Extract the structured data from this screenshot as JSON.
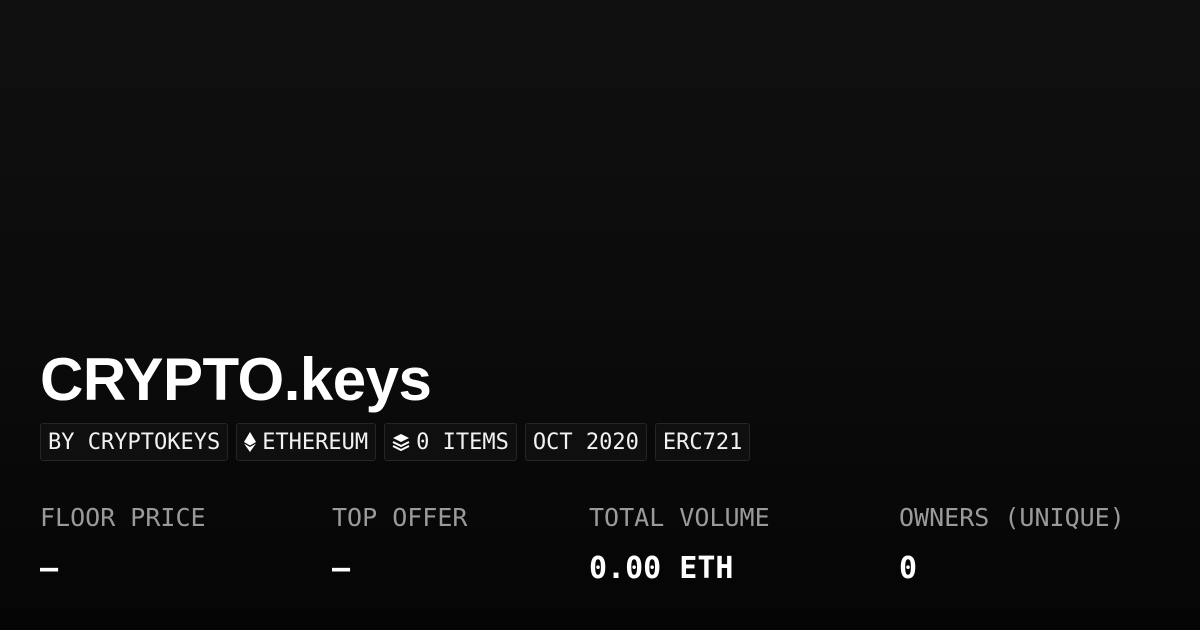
{
  "collection": {
    "name": "CRYPTO.keys"
  },
  "badges": {
    "creator": "BY CRYPTOKEYS",
    "chain": "ETHEREUM",
    "chain_icon": "ethereum-icon",
    "items": "0 ITEMS",
    "items_icon": "layers-icon",
    "created": "OCT 2020",
    "standard": "ERC721"
  },
  "stats": {
    "floor_price": {
      "label": "FLOOR PRICE",
      "value": "–"
    },
    "top_offer": {
      "label": "TOP OFFER",
      "value": "–"
    },
    "total_volume": {
      "label": "TOTAL VOLUME",
      "value": "0.00 ETH"
    },
    "owners": {
      "label": "OWNERS (UNIQUE)",
      "value": "0"
    }
  },
  "colors": {
    "background": "#0b0b0b",
    "text": "#ffffff",
    "label": "#9a9a9a",
    "badge_border": "#262626"
  }
}
